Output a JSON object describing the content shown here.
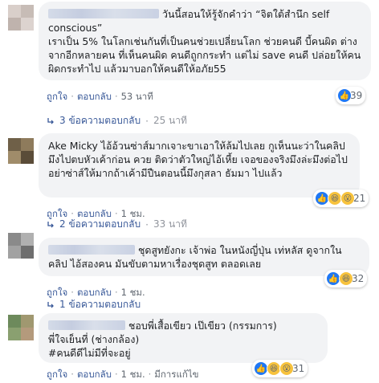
{
  "comments": [
    {
      "body": "วันนี้สอนให้รู้จักคำว่า “จิตใต้สำนึก self conscious”\nเราเป็น 5% ในโลกเช่นกันที่เป็นคนช่วยเปลี่ยนโลก ช่วยคนดี บี้คนผิด ต่างจากอีกหลายคน ที่เห็นคนผิด คนดีถูกกระทำ แต่ไม่ save คนดี ปล่อยให้คนผิดกระทำไป แล้วมาบอกให้คนดีให้อภัย55",
      "like_label": "ถูกใจ",
      "reply_label": "ตอบกลับ",
      "time": "53 นาที",
      "reaction_count": "39",
      "replies_label": "3 ข้อความตอบกลับ",
      "replies_time": "25 นาที",
      "avatar_color": "#cfc5c0"
    },
    {
      "body": "Ake Micky ไอ้อ้วนซ่าส์มากเจาะขาเอาให้ล้มไปเลย กูเห็นนะว่าในคลิปมึงไปตบหัวเค้าก่อน ควย ติดว่าตัวใหญ่ไอ้เหี้ย เจอของจริงมึงล่ะมึงต่อไปอย่าซ่าส์ให้มากถ้าเค้ามีปืนตอนนี้มึงกุสลา ธัมมา ไปแล้ว",
      "like_label": "ถูกใจ",
      "reply_label": "ตอบกลับ",
      "time": "1 ชม.",
      "reaction_count": "21",
      "replies_label": "2 ข้อความตอบกลับ",
      "replies_time": "33 นาที",
      "avatar_color": "#8c7a5a"
    },
    {
      "body": "ชุดสูทยังกะ เจ้าพ่อ ในหนังญี่ปุ่น เท่หลัส ดูจากในคลิป ไอ้สองคน มันขับตามหาเรื่องชุดสูท ตลอดเลย",
      "like_label": "ถูกใจ",
      "reply_label": "ตอบกลับ",
      "time": "1 ชม.",
      "reaction_count": "32",
      "replies_label": "1 ข้อความตอบกลับ",
      "replies_time": "",
      "avatar_color": "#9a9a9a"
    },
    {
      "body": "ชอบพี่เสื้อเขียว เป๊เขียว (กรรมการ)\nพี่ใจเย็นที่ (ช่างกล้อง)\n#คนดีดีไม่มีที่จะอยู่",
      "like_label": "ถูกใจ",
      "reply_label": "ตอบกลับ",
      "time": "1 ชม.",
      "edited_label": "มีการแก้ไข",
      "reaction_count": "31",
      "avatar_color": "#7a8f6a"
    }
  ]
}
